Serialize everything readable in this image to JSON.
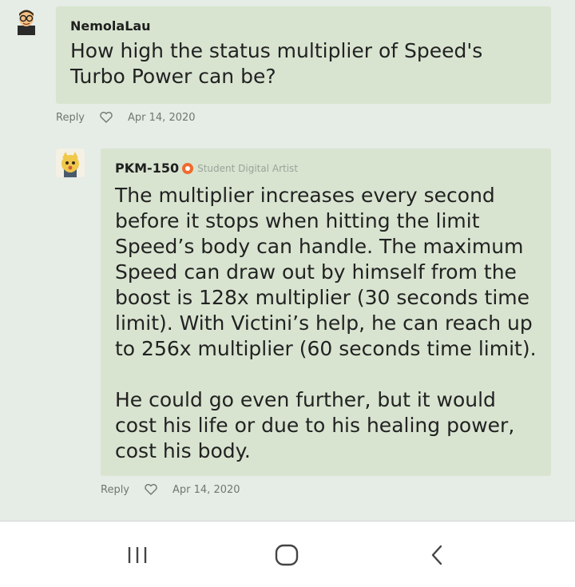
{
  "comments": [
    {
      "author": "NemolaLau",
      "message": "How high the status multiplier of Speed's\nTurbo Power can be?",
      "reply_label": "Reply",
      "date": "Apr 14, 2020"
    },
    {
      "author": "PKM-150",
      "user_title": "Student Digital Artist",
      "message": "The multiplier increases every second\nbefore it stops when hitting the limit\nSpeed’s body can handle. The maximum\nSpeed can draw out by himself from the\nboost is 128x multiplier (30 seconds time\nlimit). With Victini’s help, he can reach up\nto 256x multiplier (60 seconds time limit).\n\nHe could go even further, but it would\ncost his life or due to his healing power,\ncost his body.",
      "reply_label": "Reply",
      "date": "Apr 14, 2020"
    }
  ],
  "colors": {
    "background": "#e6ece6",
    "bubble": "#d8e4d0",
    "badge": "#f06a2e",
    "meta_text": "#6f786f"
  },
  "navbar": {
    "icons": [
      "recent-apps-icon",
      "home-icon",
      "back-icon"
    ]
  }
}
